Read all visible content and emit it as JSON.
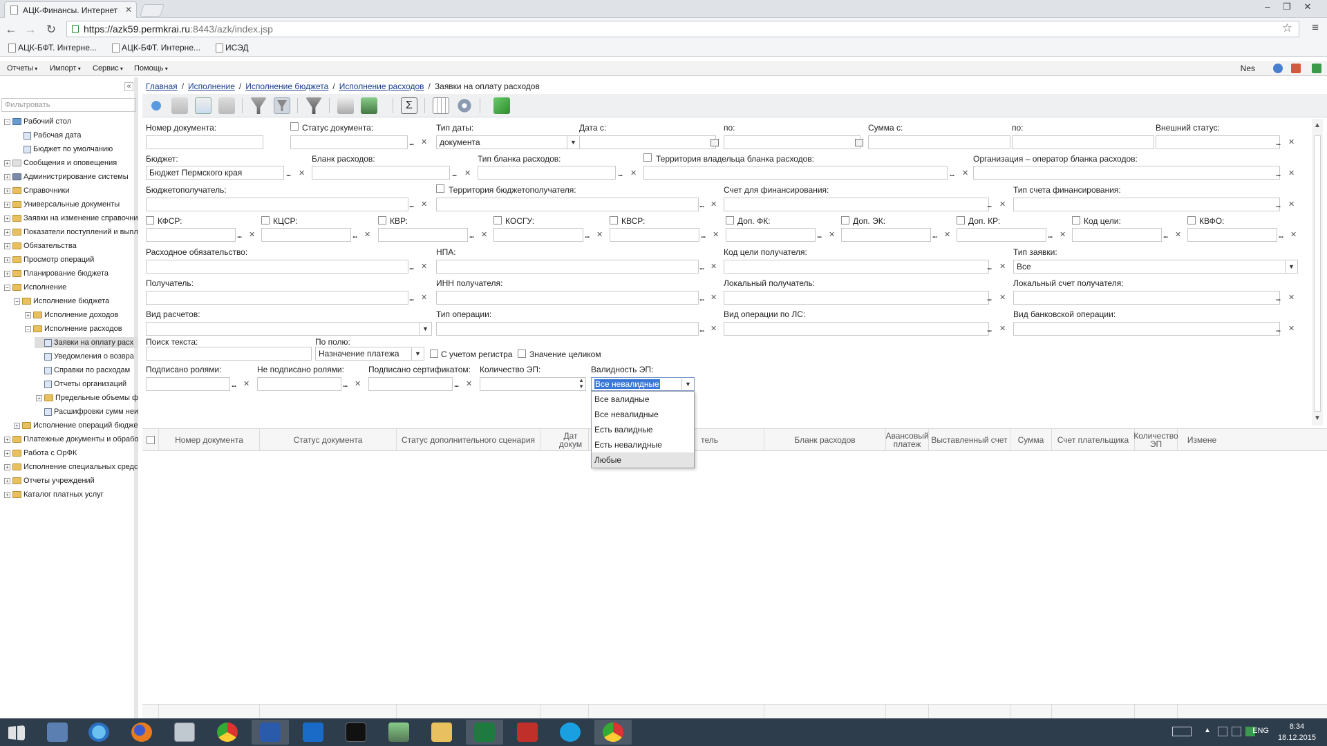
{
  "browser": {
    "tab_title": "АЦК-Финансы. Интернет",
    "url_host": "https://azk59.permkrai.ru",
    "url_rest": ":8443/azk/index.jsp",
    "bookmarks": [
      "АЦК-БФТ. Интерне...",
      "АЦК-БФТ. Интерне...",
      "ИСЭД"
    ]
  },
  "appmenu": {
    "items": [
      "Отчеты",
      "Импорт",
      "Сервис",
      "Помощь"
    ],
    "user": "Nes"
  },
  "sidebar": {
    "filter_placeholder": "Фильтровать",
    "tree": [
      {
        "label": "Рабочий стол"
      },
      {
        "label": "Рабочая дата"
      },
      {
        "label": "Бюджет по умолчанию"
      },
      {
        "label": "Сообщения и оповещения"
      },
      {
        "label": "Администрирование системы"
      },
      {
        "label": "Справочники"
      },
      {
        "label": "Универсальные документы"
      },
      {
        "label": "Заявки на изменение справочни"
      },
      {
        "label": "Показатели поступлений и выпл"
      },
      {
        "label": "Обязательства"
      },
      {
        "label": "Просмотр операций"
      },
      {
        "label": "Планирование бюджета"
      },
      {
        "label": "Исполнение"
      },
      {
        "label": "Исполнение бюджета"
      },
      {
        "label": "Исполнение доходов"
      },
      {
        "label": "Исполнение расходов"
      },
      {
        "label": "Заявки на оплату расх"
      },
      {
        "label": "Уведомления о возвра"
      },
      {
        "label": "Справки по расходам"
      },
      {
        "label": "Отчеты организаций"
      },
      {
        "label": "Предельные объемы ф"
      },
      {
        "label": "Расшифровки сумм неи"
      },
      {
        "label": "Исполнение операций бюдже"
      },
      {
        "label": "Платежные документы и обрабо"
      },
      {
        "label": "Работа с ОрФК"
      },
      {
        "label": "Исполнение специальных средс"
      },
      {
        "label": "Отчеты учреждений"
      },
      {
        "label": "Каталог платных услуг"
      }
    ]
  },
  "breadcrumb": {
    "links": [
      "Главная",
      "Исполнение",
      "Исполнение бюджета",
      "Исполнение расходов"
    ],
    "current": "Заявки на оплату расходов"
  },
  "form": {
    "labels": {
      "doc_number": "Номер документа:",
      "doc_status": "Статус документа:",
      "date_type": "Тип даты:",
      "date_from": "Дата с:",
      "to1": "по:",
      "sum_from": "Сумма с:",
      "to2": "по:",
      "ext_status": "Внешний статус:",
      "budget": "Бюджет:",
      "form_exp": "Бланк расходов:",
      "form_type": "Тип бланка расходов:",
      "owner_terr": "Территория владельца бланка расходов:",
      "operator_org": "Организация – оператор бланка расходов:",
      "recipient": "Бюджетополучатель:",
      "recipient_terr": "Территория бюджетополучателя:",
      "fin_account": "Счет для финансирования:",
      "fin_account_type": "Тип счета финансирования:",
      "kfsr": "КФСР:",
      "kcsr": "КЦСР:",
      "kvr": "КВР:",
      "kosgu": "КОСГУ:",
      "kvsr": "КВСР:",
      "dop_fk": "Доп. ФК:",
      "dop_ek": "Доп. ЭК:",
      "dop_kr": "Доп. КР:",
      "goal_code": "Код цели:",
      "kvfo": "КВФО:",
      "exp_obligation": "Расходное обязательство:",
      "npa": "НПА:",
      "goal_code_recipient": "Код цели получателя:",
      "request_type": "Тип заявки:",
      "payee": "Получатель:",
      "payee_inn": "ИНН получателя:",
      "local_payee": "Локальный получатель:",
      "local_payee_account": "Локальный счет получателя:",
      "settlement_type": "Вид расчетов:",
      "operation_type": "Тип операции:",
      "ls_operation_type": "Вид операции по ЛС:",
      "bank_operation_type": "Вид банковской операции:",
      "text_search": "Поиск текста:",
      "by_field": "По полю:",
      "case_sensitive": "С учетом регистра",
      "whole_value": "Значение целиком",
      "signed_roles": "Подписано ролями:",
      "not_signed_roles": "Не подписано ролями:",
      "signed_cert": "Подписано сертификатом:",
      "ep_count": "Количество ЭП:",
      "ep_validity": "Валидность ЭП:"
    },
    "values": {
      "date_type": "документа",
      "budget": "Бюджет Пермского края",
      "request_type": "Все",
      "by_field": "Назначение платежа",
      "ep_validity": "Все невалидные"
    },
    "ep_validity_options": [
      "Все валидные",
      "Все невалидные",
      "Есть валидные",
      "Есть невалидные",
      "Любые"
    ]
  },
  "grid": {
    "columns": [
      "Номер документа",
      "Статус документа",
      "Статус дополнительного сценария",
      "Дата документа",
      "Получатель",
      "Бланк расходов",
      "Авансовый платеж",
      "Выставленный счет",
      "Сумма",
      "Счет плательщика",
      "Количество ЭП",
      "Измене"
    ],
    "col_date_visible": "Дат докум",
    "col_recipient_visible": "тель"
  },
  "taskbar": {
    "lang": "ENG",
    "time": "8:34",
    "date": "18.12.2015"
  }
}
